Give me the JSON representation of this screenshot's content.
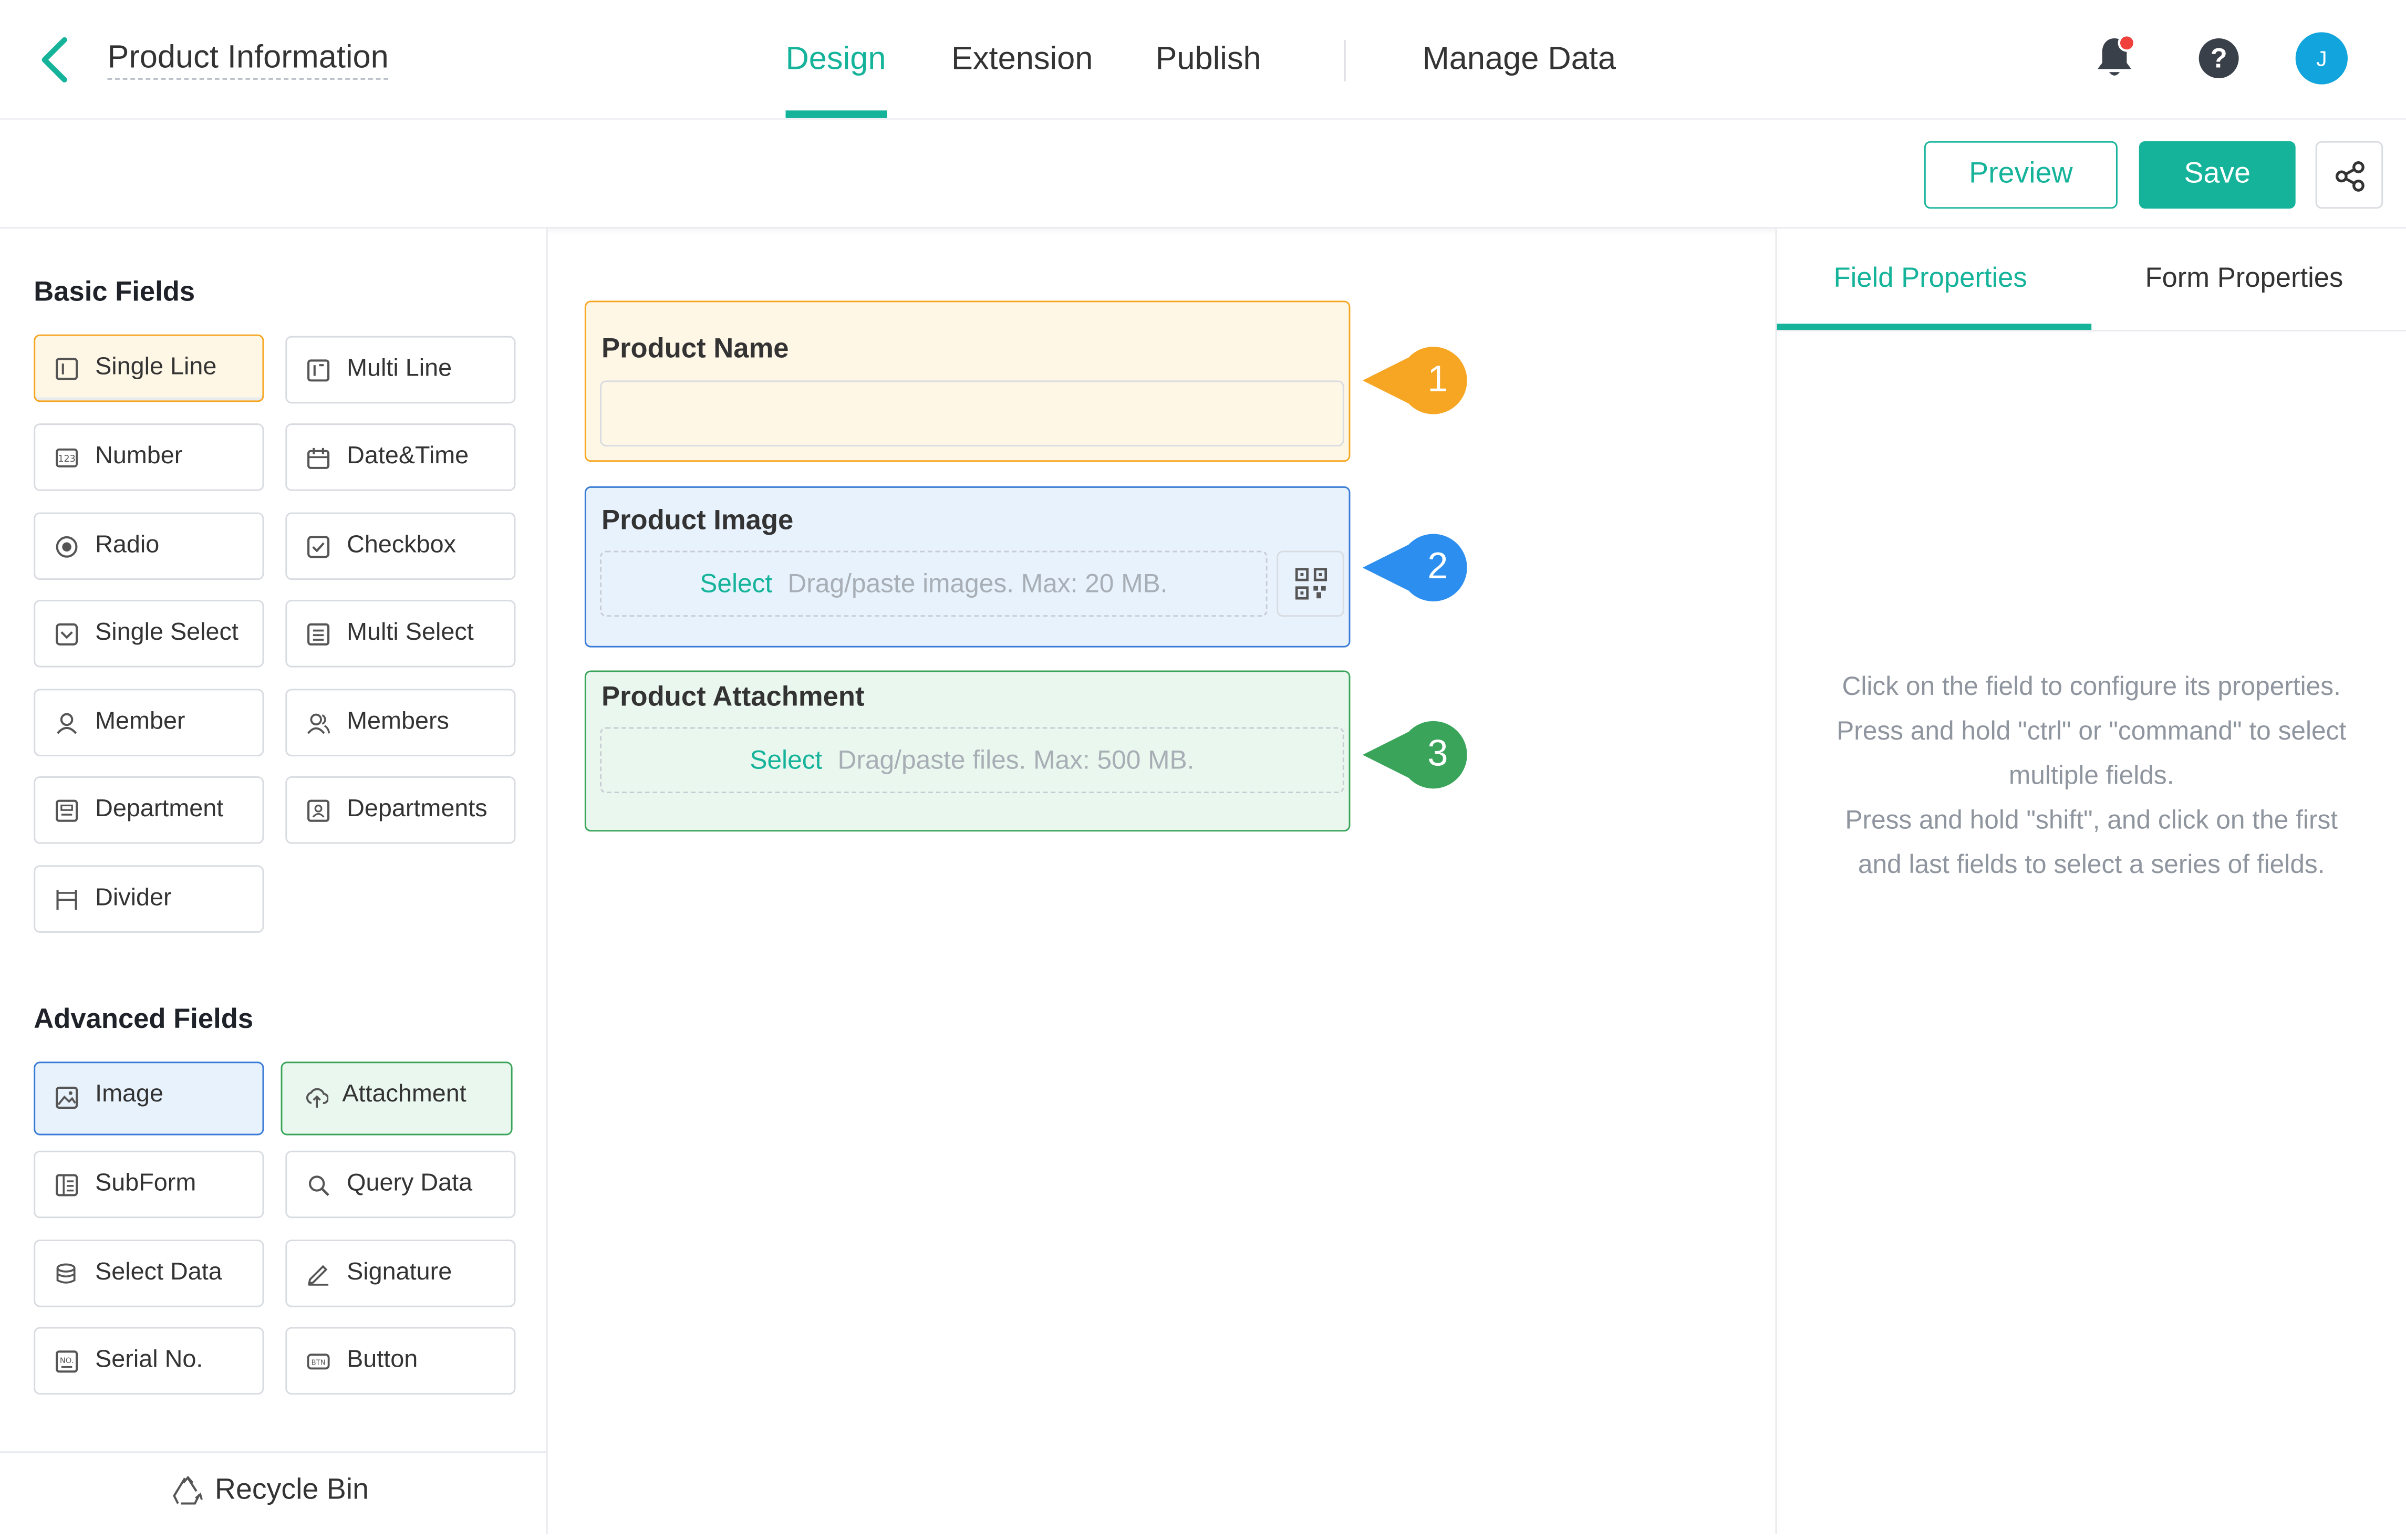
{
  "header": {
    "title": "Product Information",
    "tabs": [
      "Design",
      "Extension",
      "Publish",
      "Manage Data"
    ],
    "active_tab": "Design",
    "avatar_initial": "J",
    "help_symbol": "?",
    "icons": [
      "back-arrow-icon",
      "bell-icon",
      "help-icon"
    ]
  },
  "toolbar": {
    "preview_label": "Preview",
    "save_label": "Save",
    "share_icon": "share-icon"
  },
  "left_panel": {
    "basic_title": "Basic Fields",
    "basic_fields": [
      "Single Line",
      "Multi Line",
      "Number",
      "Date&Time",
      "Radio",
      "Checkbox",
      "Single Select",
      "Multi Select",
      "Member",
      "Members",
      "Department",
      "Departments",
      "Divider"
    ],
    "advanced_title": "Advanced Fields",
    "advanced_fields": [
      "Image",
      "Attachment",
      "SubForm",
      "Query Data",
      "Select Data",
      "Signature",
      "Serial No.",
      "Button"
    ],
    "recycle_label": "Recycle Bin"
  },
  "canvas": {
    "fields": [
      {
        "label": "Product Name",
        "badge": "1",
        "color": "#f6a623"
      },
      {
        "label": "Product Image",
        "select": "Select",
        "hint": "Drag/paste images. Max: 20 MB.",
        "badge": "2",
        "color": "#2c8ff0"
      },
      {
        "label": "Product Attachment",
        "select": "Select",
        "hint": "Drag/paste files. Max: 500 MB.",
        "badge": "3",
        "color": "#3aa55a"
      }
    ]
  },
  "right_panel": {
    "tabs": [
      "Field Properties",
      "Form Properties"
    ],
    "active_tab": "Field Properties",
    "hint_lines": [
      "Click on the field to configure its properties.",
      "Press and hold \"ctrl\" or \"command\" to select",
      "multiple fields.",
      "Press and hold \"shift\", and click on the first",
      "and last fields to select a series of fields."
    ]
  },
  "colors": {
    "accent": "#14b39a",
    "orange": "#f6a623",
    "blue": "#2c8ff0",
    "green": "#3aa55a"
  }
}
